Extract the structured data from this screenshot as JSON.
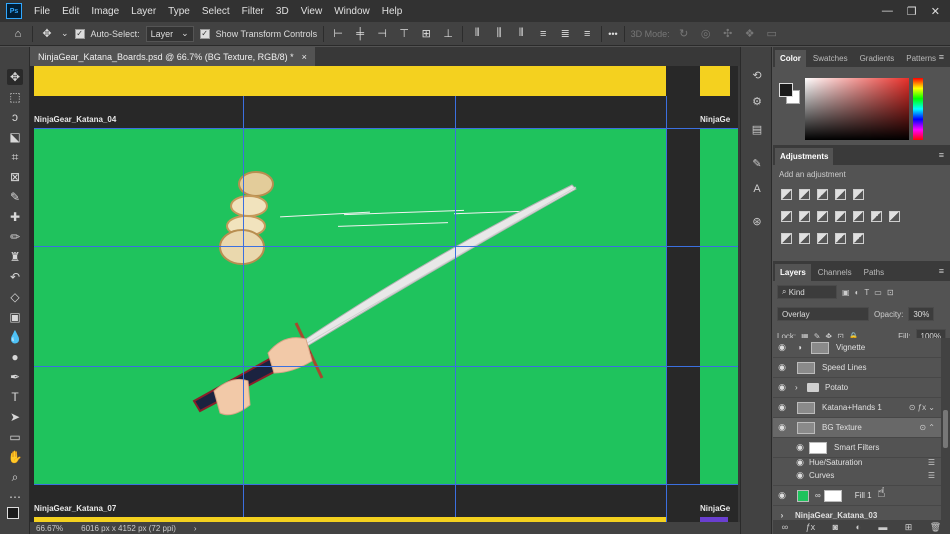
{
  "app": {
    "logo": "Ps"
  },
  "menu": [
    "File",
    "Edit",
    "Image",
    "Layer",
    "Type",
    "Select",
    "Filter",
    "3D",
    "View",
    "Window",
    "Help"
  ],
  "window_controls": {
    "minimize": "—",
    "restore": "❐",
    "close": "✕"
  },
  "options_bar": {
    "auto_select_label": "Auto-Select:",
    "auto_select_value": "Layer",
    "show_transform_label": "Show Transform Controls",
    "more": "•••",
    "mode_3d": "3D Mode:"
  },
  "document": {
    "tab_title": "NinjaGear_Katana_Boards.psd @ 66.7% (BG Texture, RGB/8) *",
    "close": "×"
  },
  "canvas": {
    "artboard_main_label": "NinjaGear_Katana_04",
    "artboard_right_label": "NinjaGe",
    "artboard_bottom_label": "NinjaGear_Katana_07",
    "artboard_bottom_right_label": "NinjaGe",
    "green": "#1fc35d",
    "yellow": "#f4d11f"
  },
  "status": {
    "zoom": "66.67%",
    "doc_info": "6016 px x 4152 px (72 ppi)",
    "arrow": "›"
  },
  "panels": {
    "color_tabs": [
      "Color",
      "Swatches",
      "Gradients",
      "Patterns"
    ],
    "adjustments_tab": "Adjustments",
    "adjustments_hint": "Add an adjustment",
    "layers_tabs": [
      "Layers",
      "Channels",
      "Paths"
    ],
    "kind_filter": "Kind",
    "blend_mode": "Overlay",
    "opacity_label": "Opacity:",
    "opacity_value": "30%",
    "lock_label": "Lock:",
    "fill_label": "Fill:",
    "fill_value": "100%"
  },
  "layers": [
    {
      "name": "Vignette",
      "type": "adjustment"
    },
    {
      "name": "Speed Lines",
      "type": "smart"
    },
    {
      "name": "Potato",
      "type": "group"
    },
    {
      "name": "Katana+Hands 1",
      "type": "smart"
    },
    {
      "name": "BG Texture",
      "type": "smart",
      "selected": true
    },
    {
      "name": "Smart Filters",
      "type": "filter-mask"
    },
    {
      "name": "Hue/Saturation",
      "type": "filter"
    },
    {
      "name": "Curves",
      "type": "filter"
    },
    {
      "name": "Fill 1",
      "type": "fill"
    },
    {
      "name": "NinjaGear_Katana_03",
      "type": "artboard"
    }
  ]
}
